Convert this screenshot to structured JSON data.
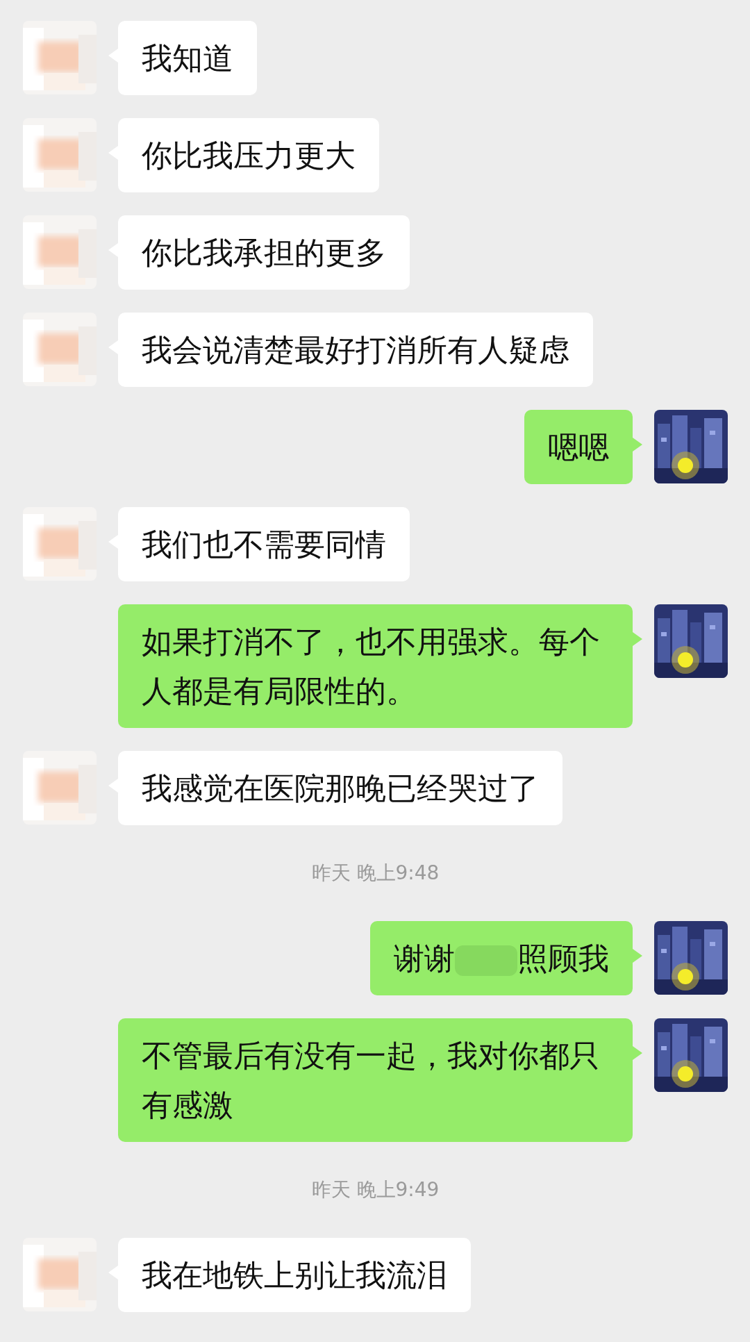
{
  "messages": [
    {
      "kind": "message",
      "outgoing": false,
      "text": "我知道"
    },
    {
      "kind": "message",
      "outgoing": false,
      "text": "你比我压力更大"
    },
    {
      "kind": "message",
      "outgoing": false,
      "text": "你比我承担的更多"
    },
    {
      "kind": "message",
      "outgoing": false,
      "text": "我会说清楚最好打消所有人疑虑"
    },
    {
      "kind": "message",
      "outgoing": true,
      "text": "嗯嗯"
    },
    {
      "kind": "message",
      "outgoing": false,
      "text": "我们也不需要同情"
    },
    {
      "kind": "message",
      "outgoing": true,
      "text": "如果打消不了，也不用强求。每个人都是有局限性的。"
    },
    {
      "kind": "message",
      "outgoing": false,
      "text": "我感觉在医院那晚已经哭过了"
    },
    {
      "kind": "time",
      "text": "昨天 晚上9:48"
    },
    {
      "kind": "message",
      "outgoing": true,
      "segments": [
        {
          "kind": "text",
          "text": "谢谢"
        },
        {
          "kind": "redacted"
        },
        {
          "kind": "text",
          "text": "照顾我"
        }
      ]
    },
    {
      "kind": "message",
      "outgoing": true,
      "text": "不管最后有没有一起，我对你都只有感激"
    },
    {
      "kind": "time",
      "text": "昨天 晚上9:49"
    },
    {
      "kind": "message",
      "outgoing": false,
      "text": "我在地铁上别让我流泪"
    }
  ]
}
